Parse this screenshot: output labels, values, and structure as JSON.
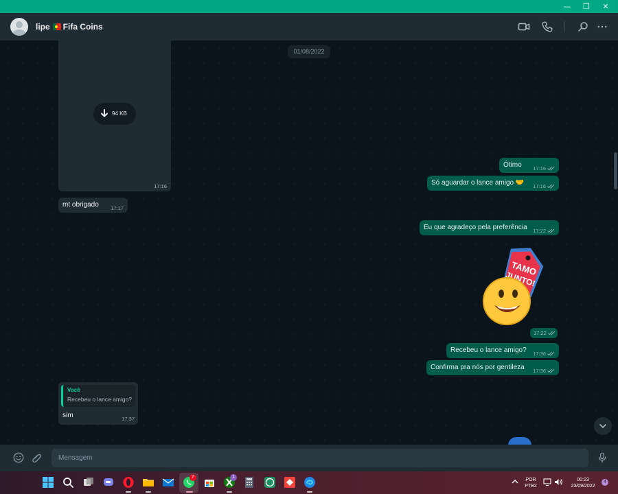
{
  "window": {
    "controls": {
      "minimize": "—",
      "maximize": "❐",
      "close": "✕"
    }
  },
  "header": {
    "contact_name": "lipe",
    "contact_suffix": "Fifa Coins",
    "icons": [
      "video-call-icon",
      "voice-call-icon",
      "search-icon",
      "menu-icon"
    ]
  },
  "chat": {
    "date_separator": "01/08/2022",
    "document": {
      "size": "94 KB",
      "time": "17:16"
    },
    "messages": [
      {
        "dir": "out",
        "text": "Ótimo",
        "time": "17:16"
      },
      {
        "dir": "out",
        "text": "Só aguardar o lance amigo 🤝",
        "time": "17:16"
      },
      {
        "dir": "in",
        "text": "mt obrigado",
        "time": "17:17"
      },
      {
        "dir": "out",
        "text": "Eu que agradeço pela preferência",
        "time": "17:22"
      },
      {
        "dir": "out",
        "text": "Recebeu o lance amigo?",
        "time": "17:36"
      },
      {
        "dir": "out",
        "text": "Confirma pra nós por gentileza",
        "time": "17:36"
      }
    ],
    "sticker": {
      "text_line1": "TAMO",
      "text_line2": "JUNTO!",
      "time": "17:22"
    },
    "reply": {
      "quote_author": "Você",
      "quote_text": "Recebeu o lance amigo?",
      "text": "sim",
      "time": "17:37"
    }
  },
  "compose": {
    "placeholder": "Mensagem",
    "icons": [
      "emoji-icon",
      "attach-icon",
      "microphone-icon"
    ]
  },
  "taskbar": {
    "apps": [
      "windows-start",
      "search",
      "task-view",
      "teams-chat",
      "opera",
      "file-explorer",
      "mail",
      "whatsapp",
      "microsoft-store",
      "xbox",
      "calculator",
      "whatsapp-alt",
      "anydesk",
      "edge"
    ],
    "whatsapp_badge": "7",
    "xbox_badge": "1",
    "language_line1": "POR",
    "language_line2": "PTB2",
    "clock_time": "00:23",
    "clock_date": "23/09/2022",
    "notification_count": "4"
  },
  "colors": {
    "accent": "#00a884",
    "outgoing_bubble": "#005c4b",
    "incoming_bubble": "#202c33",
    "background": "#0b141a"
  }
}
